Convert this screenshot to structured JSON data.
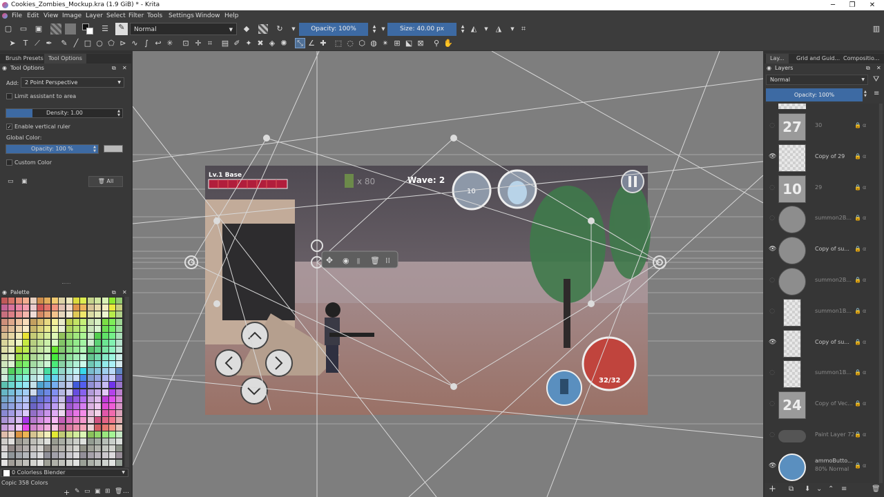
{
  "window": {
    "title": "Cookies_Zombies_Mockup.kra (1.9 GiB) * - Krita",
    "minimize": "─",
    "maximize": "❐",
    "close": "✕"
  },
  "menu": [
    "File",
    "Edit",
    "View",
    "Image",
    "Layer",
    "Select",
    "Filter",
    "Tools",
    "Settings",
    "Window",
    "Help"
  ],
  "toolbar": {
    "blend_mode": "Normal",
    "opacity": "Opacity: 100%",
    "size": "Size: 40.00 px"
  },
  "left_tabs": [
    "Brush Presets",
    "Tool Options"
  ],
  "tool_options": {
    "title": "Tool Options",
    "add_label": "Add:",
    "add_value": "2 Point Perspective",
    "limit_assistant": "Limit assistant to area",
    "density": "Density: 1.00",
    "enable_vertical_ruler": "Enable vertical ruler",
    "global_color": "Global Color:",
    "opacity": "Opacity: 100 %",
    "custom_color": "Custom Color",
    "all_button": "All"
  },
  "palette": {
    "title": "Palette",
    "blender": "0 Colorless Blender",
    "count": "Copic 358 Colors"
  },
  "right_tabs": [
    "Lay...",
    "Grid and Guid...",
    "Compositio..."
  ],
  "layers_panel": {
    "title": "Layers",
    "blend_mode": "Normal",
    "opacity": "Opacity: 100%"
  },
  "layers": [
    {
      "name": "30",
      "visible": false,
      "thumb": "num",
      "label": "27"
    },
    {
      "name": "Copy of 29",
      "visible": true,
      "thumb": "checker",
      "label": ""
    },
    {
      "name": "29",
      "visible": false,
      "thumb": "num",
      "label": "10"
    },
    {
      "name": "summon2B...",
      "visible": false,
      "thumb": "circle",
      "label": ""
    },
    {
      "name": "Copy of su...",
      "visible": true,
      "thumb": "circle",
      "label": ""
    },
    {
      "name": "summon2B...",
      "visible": false,
      "thumb": "circle",
      "label": ""
    },
    {
      "name": "summon1B...",
      "visible": false,
      "thumb": "small",
      "label": ""
    },
    {
      "name": "Copy of su...",
      "visible": true,
      "thumb": "small",
      "label": ""
    },
    {
      "name": "summon1B...",
      "visible": false,
      "thumb": "small",
      "label": ""
    },
    {
      "name": "Copy of Vec...",
      "visible": false,
      "thumb": "num",
      "label": "24"
    },
    {
      "name": "Paint Layer 72",
      "visible": false,
      "thumb": "glasses",
      "label": ""
    },
    {
      "name": "ammoButto...",
      "sub": "80% Normal",
      "visible": true,
      "thumb": "ammo",
      "label": ""
    }
  ],
  "game": {
    "base_label": "Lv.1 Base",
    "ammo_count": "x 80",
    "wave": "Wave: 2",
    "summon_count": "10",
    "clip": "32/32"
  },
  "colors": {
    "accent_blue": "#3d6aa3",
    "panel": "#383838",
    "canvas_bg": "#7e7e7e"
  }
}
